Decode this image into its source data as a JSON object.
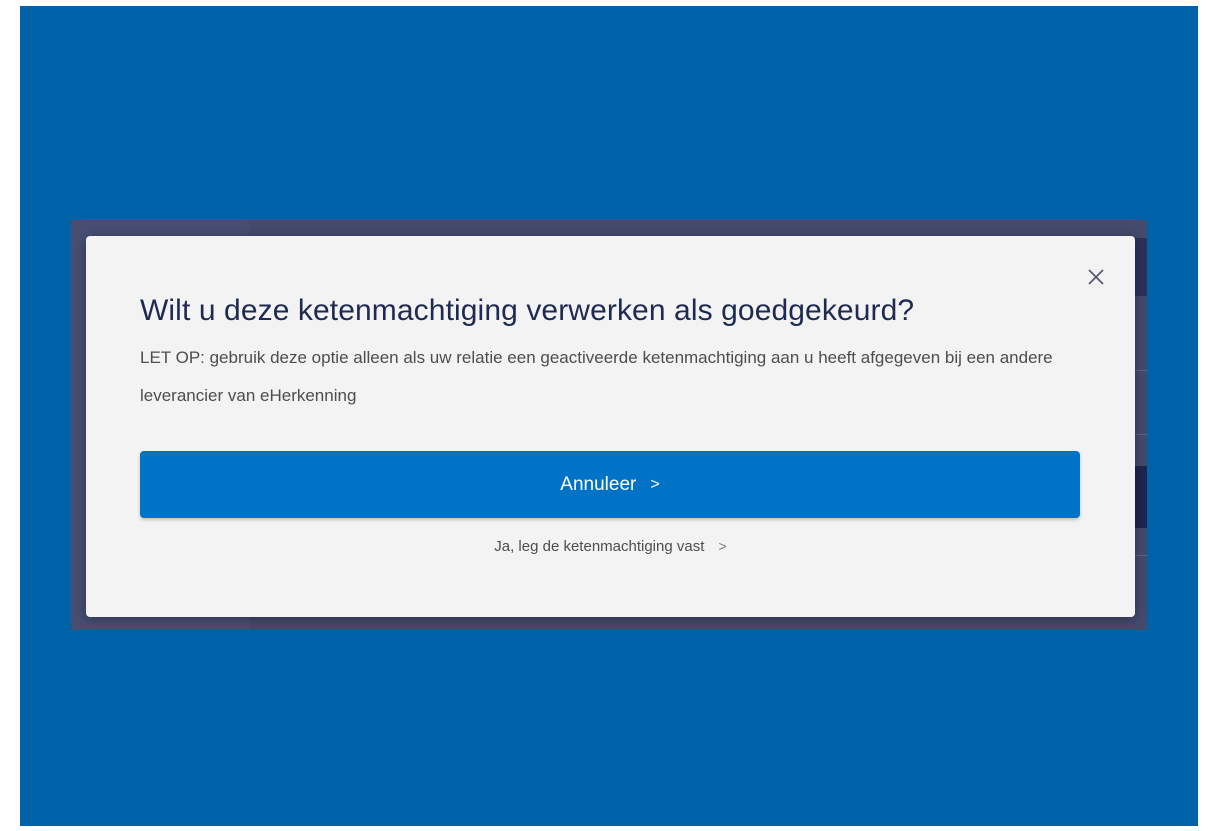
{
  "dialog": {
    "title": "Wilt u deze ketenmachtiging verwerken als goedgekeurd?",
    "message": "LET OP: gebruik deze optie alleen als uw relatie een geactiveerde ketenmachtiging aan u heeft afgegeven bij een andere leverancier van eHerkenning",
    "primary_button": "Annuleer",
    "primary_chevron": ">",
    "secondary_link": "Ja, leg de ketenmachtiging vast",
    "secondary_chevron": ">",
    "close_icon": "close-icon"
  },
  "colors": {
    "page_background": "#0063a9",
    "overlay": "#434a6c",
    "modal_background": "#f3f3f3",
    "title_text": "#1f2a52",
    "primary_button": "#0073c7"
  }
}
